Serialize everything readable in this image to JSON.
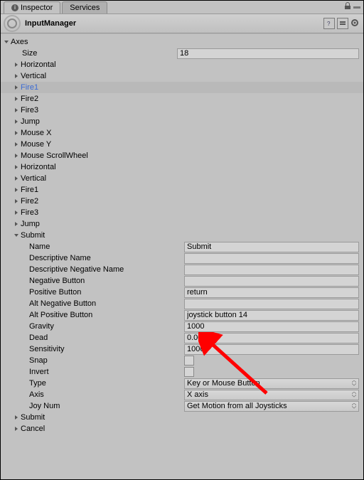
{
  "tabs": {
    "inspector": "Inspector",
    "services": "Services"
  },
  "header": {
    "title": "InputManager"
  },
  "axes": {
    "header": "Axes",
    "size_label": "Size",
    "size_value": "18",
    "items": [
      {
        "label": "Horizontal",
        "expanded": false,
        "highlight": false
      },
      {
        "label": "Vertical",
        "expanded": false,
        "highlight": false
      },
      {
        "label": "Fire1",
        "expanded": false,
        "highlight": true
      },
      {
        "label": "Fire2",
        "expanded": false,
        "highlight": false
      },
      {
        "label": "Fire3",
        "expanded": false,
        "highlight": false
      },
      {
        "label": "Jump",
        "expanded": false,
        "highlight": false
      },
      {
        "label": "Mouse X",
        "expanded": false,
        "highlight": false
      },
      {
        "label": "Mouse Y",
        "expanded": false,
        "highlight": false
      },
      {
        "label": "Mouse ScrollWheel",
        "expanded": false,
        "highlight": false
      },
      {
        "label": "Horizontal",
        "expanded": false,
        "highlight": false
      },
      {
        "label": "Vertical",
        "expanded": false,
        "highlight": false
      },
      {
        "label": "Fire1",
        "expanded": false,
        "highlight": false
      },
      {
        "label": "Fire2",
        "expanded": false,
        "highlight": false
      },
      {
        "label": "Fire3",
        "expanded": false,
        "highlight": false
      },
      {
        "label": "Jump",
        "expanded": false,
        "highlight": false
      },
      {
        "label": "Submit",
        "expanded": true,
        "highlight": false
      },
      {
        "label": "Submit",
        "expanded": false,
        "highlight": false
      },
      {
        "label": "Cancel",
        "expanded": false,
        "highlight": false
      }
    ]
  },
  "submit": {
    "fields": {
      "name": {
        "label": "Name",
        "value": "Submit"
      },
      "descriptive_name": {
        "label": "Descriptive Name",
        "value": ""
      },
      "descriptive_negative_name": {
        "label": "Descriptive Negative Name",
        "value": ""
      },
      "negative_button": {
        "label": "Negative Button",
        "value": ""
      },
      "positive_button": {
        "label": "Positive Button",
        "value": "return"
      },
      "alt_negative_button": {
        "label": "Alt Negative Button",
        "value": ""
      },
      "alt_positive_button": {
        "label": "Alt Positive Button",
        "value": "joystick button 14"
      },
      "gravity": {
        "label": "Gravity",
        "value": "1000"
      },
      "dead": {
        "label": "Dead",
        "value": "0.001"
      },
      "sensitivity": {
        "label": "Sensitivity",
        "value": "1000"
      },
      "snap": {
        "label": "Snap",
        "value": false
      },
      "invert": {
        "label": "Invert",
        "value": false
      },
      "type": {
        "label": "Type",
        "value": "Key or Mouse Button"
      },
      "axis": {
        "label": "Axis",
        "value": "X axis"
      },
      "joy_num": {
        "label": "Joy Num",
        "value": "Get Motion from all Joysticks"
      }
    }
  },
  "annotation": {
    "color": "#ff0000"
  }
}
